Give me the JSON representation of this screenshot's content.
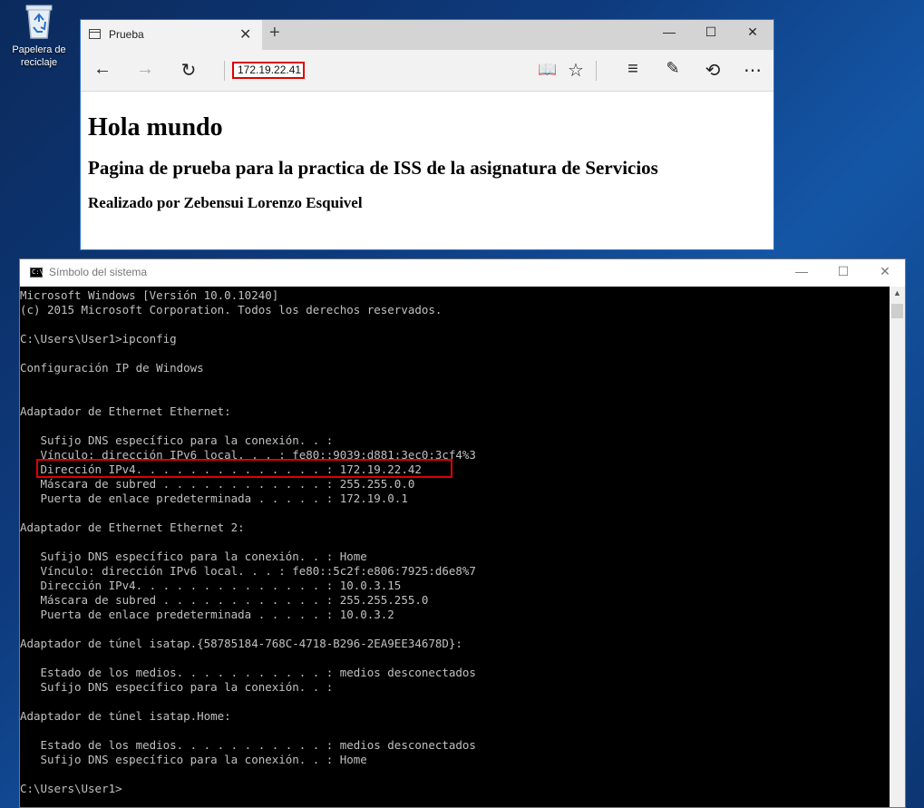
{
  "desktop": {
    "recycle_bin_label": "Papelera de reciclaje"
  },
  "browser": {
    "tab_title": "Prueba",
    "address": "172.19.22.41",
    "page": {
      "heading1": "Hola mundo",
      "heading2": "Pagina de prueba para la practica de ISS de la asignatura de Servicios",
      "heading3": "Realizado por Zebensui Lorenzo Esquivel"
    }
  },
  "cmd": {
    "title": "Símbolo del sistema",
    "lines": [
      "Microsoft Windows [Versión 10.0.10240]",
      "(c) 2015 Microsoft Corporation. Todos los derechos reservados.",
      "",
      "C:\\Users\\User1>ipconfig",
      "",
      "Configuración IP de Windows",
      "",
      "",
      "Adaptador de Ethernet Ethernet:",
      "",
      "   Sufijo DNS específico para la conexión. . :",
      "   Vínculo: dirección IPv6 local. . . : fe80::9039:d881:3ec0:3cf4%3",
      "   Dirección IPv4. . . . . . . . . . . . . . : 172.19.22.42",
      "   Máscara de subred . . . . . . . . . . . . : 255.255.0.0",
      "   Puerta de enlace predeterminada . . . . . : 172.19.0.1",
      "",
      "Adaptador de Ethernet Ethernet 2:",
      "",
      "   Sufijo DNS específico para la conexión. . : Home",
      "   Vínculo: dirección IPv6 local. . . : fe80::5c2f:e806:7925:d6e8%7",
      "   Dirección IPv4. . . . . . . . . . . . . . : 10.0.3.15",
      "   Máscara de subred . . . . . . . . . . . . : 255.255.255.0",
      "   Puerta de enlace predeterminada . . . . . : 10.0.3.2",
      "",
      "Adaptador de túnel isatap.{58785184-768C-4718-B296-2EA9EE34678D}:",
      "",
      "   Estado de los medios. . . . . . . . . . . : medios desconectados",
      "   Sufijo DNS específico para la conexión. . :",
      "",
      "Adaptador de túnel isatap.Home:",
      "",
      "   Estado de los medios. . . . . . . . . . . : medios desconectados",
      "   Sufijo DNS específico para la conexión. . : Home",
      "",
      "C:\\Users\\User1>"
    ]
  },
  "colors": {
    "highlight": "#e00000",
    "console_text": "#c0c0c0",
    "console_bg": "#000000"
  }
}
